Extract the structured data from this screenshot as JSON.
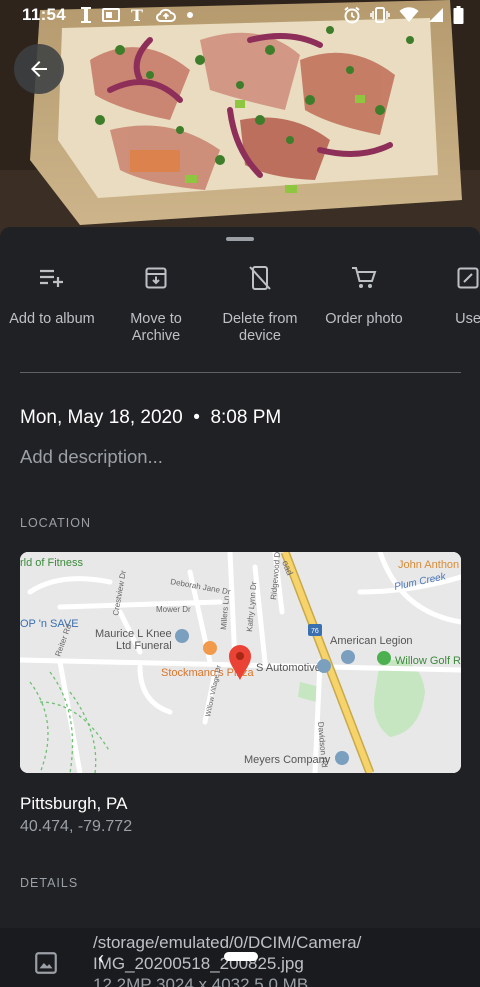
{
  "status_bar": {
    "time": "11:54",
    "left_icons": [
      "instapaper-icon",
      "news-icon",
      "nytimes-icon",
      "cloud-upload-icon",
      "dot-icon"
    ],
    "right_icons": [
      "alarm-icon",
      "vibrate-icon",
      "wifi-icon",
      "signal-icon",
      "battery-icon"
    ]
  },
  "photo": {
    "subject": "flatbread pizza with bacon, red onion, tomato and herbs"
  },
  "actions": [
    {
      "label": "Add to album",
      "icon": "playlist-add-icon"
    },
    {
      "label": "Move to\nArchive",
      "icon": "archive-icon"
    },
    {
      "label": "Delete from\ndevice",
      "icon": "delete-from-device-icon"
    },
    {
      "label": "Order photo",
      "icon": "cart-icon"
    },
    {
      "label": "Use",
      "icon": "edit-icon"
    }
  ],
  "info": {
    "date": "Mon, May 18, 2020",
    "time": "8:08 PM",
    "description_placeholder": "Add description..."
  },
  "location": {
    "section_label": "LOCATION",
    "place": "Pittsburgh, PA",
    "coords": "40.474, -79.772",
    "map_labels": {
      "fitness": "rld of Fitness",
      "john": "John Anthon",
      "deborah": "Deborah Jane Dr",
      "mower": "Mower Dr",
      "crestview": "Crestview Dr",
      "millers": "Millers Ln",
      "kathy": "Kathy Lynn Dr",
      "ridgewood": "Ridgewood Dr",
      "plum": "Plum Creek",
      "npsave": "OP 'n SAVE",
      "maurice": "Maurice L Knee",
      "funeral": "Ltd Funeral",
      "road": "oad",
      "route": "76",
      "legion": "American Legion",
      "golf": "Willow Golf R",
      "reiter": "Reiter Rd",
      "stockmano": "Stockmano's Pizza",
      "automotive": "S Automotive",
      "willow_village": "Willow Village Dr",
      "davidson": "Davidson Rd",
      "meyers": "Meyers Company"
    }
  },
  "details": {
    "section_label": "DETAILS",
    "path": "/storage/emulated/0/DCIM/Camera/",
    "filename": "IMG_20200518_200825.jpg",
    "meta": "12.2MP    3024 x 4032    5.0 MB"
  },
  "nav": {
    "back": "‹"
  },
  "colors": {
    "background": "#202124",
    "accent_pin": "#ea4335",
    "road_yellow": "#f6d36b"
  }
}
